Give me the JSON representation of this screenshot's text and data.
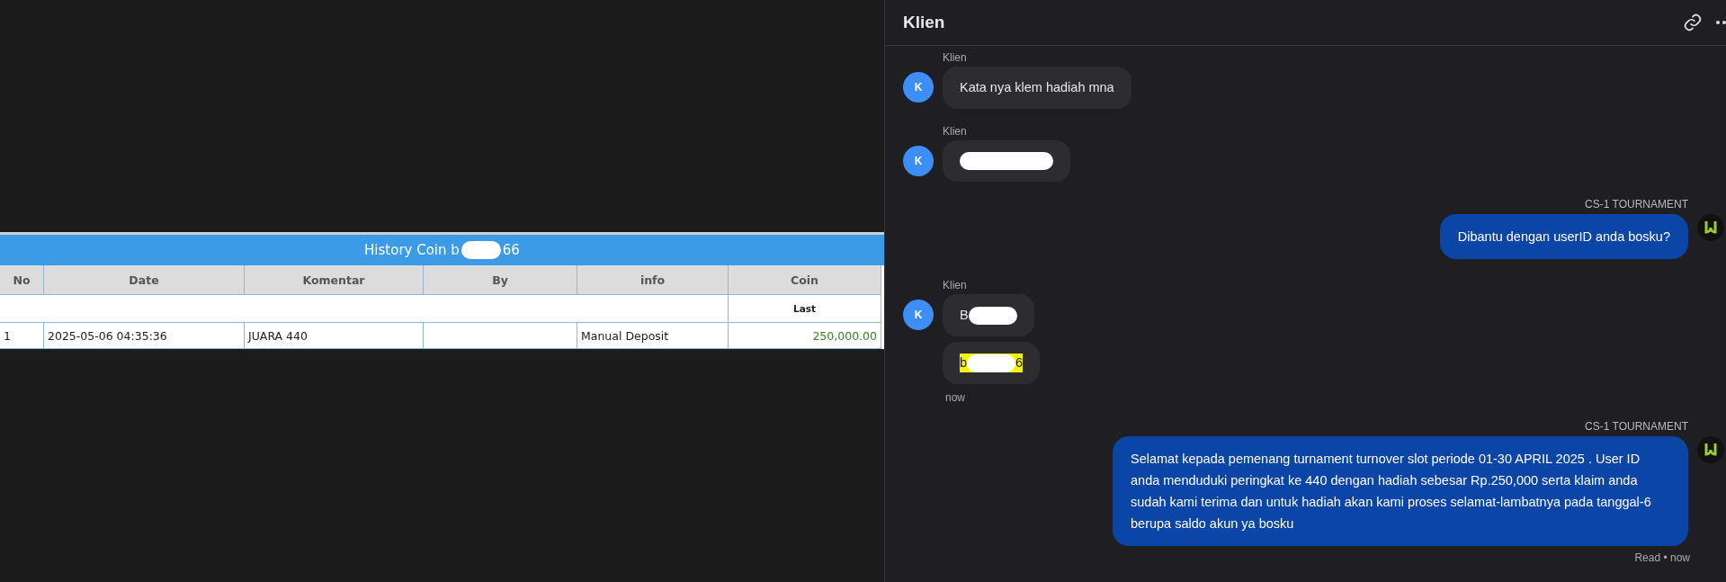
{
  "history": {
    "title_start": "History Coin b",
    "title_end": "66",
    "columns": [
      "No",
      "Date",
      "Komentar",
      "By",
      "info",
      "Coin"
    ],
    "subheader": "Last",
    "rows": [
      {
        "cells": [
          "1",
          "2025-05-06 04:35:36",
          "JUARA 440",
          null,
          "Manual Deposit",
          "250,000.00"
        ]
      }
    ]
  },
  "chat": {
    "title": "Klien",
    "messages": [
      {
        "kind": "incoming",
        "sender": "Klien",
        "avatar": "K",
        "bubbles": [
          {
            "kind": "text",
            "text": "Kata nya klem hadiah mna"
          }
        ]
      },
      {
        "kind": "incoming",
        "sender": "Klien",
        "avatar": "K",
        "bubbles": [
          {
            "kind": "redacted",
            "highlighted": false
          }
        ]
      },
      {
        "kind": "outgoing",
        "sender": "CS-1 TOURNAMENT",
        "bubbles": [
          {
            "kind": "text",
            "text": "Dibantu dengan userID anda bosku?"
          }
        ]
      },
      {
        "kind": "incoming",
        "sender": "Klien",
        "avatar": "K",
        "time": "now",
        "bubbles": [
          {
            "kind": "redacted",
            "lead": "B",
            "highlighted": false
          },
          {
            "kind": "redacted",
            "lead": "b",
            "tail": "6",
            "highlighted": true
          }
        ]
      },
      {
        "kind": "outgoing",
        "sender": "CS-1 TOURNAMENT",
        "receipt": "Read • now",
        "bubbles": [
          {
            "kind": "text",
            "text": "Selamat kepada pemenang turnament turnover slot periode 01-30 APRIL 2025 . User ID anda menduduki peringkat ke 440 dengan hadiah sebesar Rp.250,000 serta klaim anda sudah kami terima dan untuk hadiah akan kami proses selamat-lambatnya pada tanggal-6 berupa saldo akun ya bosku"
          }
        ]
      }
    ]
  }
}
